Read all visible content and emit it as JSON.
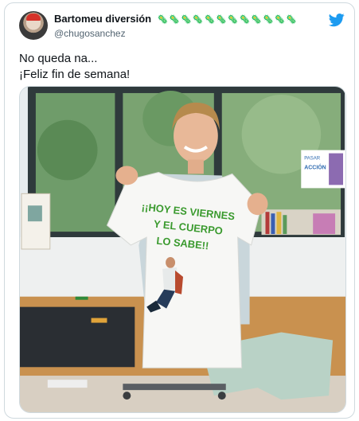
{
  "tweet": {
    "display_name": "Bartomeu diversión",
    "name_emojis": "🦠🦠🦠🦠🦠🦠🦠🦠🦠🦠🦠🦠",
    "handle": "@chugosanchez",
    "text_line1": "No queda na...",
    "text_line2": "¡Feliz fin de semana!"
  },
  "media": {
    "shirt_text": [
      "¡¡HOY ES VIERNES",
      "Y EL CUERPO",
      "LO SABE!!"
    ],
    "wall_sign": [
      "PASAR",
      "ACCIÓN"
    ]
  },
  "colors": {
    "twitter_blue": "#1d9bf0",
    "shirt_green": "#3a9a2e"
  },
  "icons": {
    "platform": "twitter-bird-icon",
    "avatar": "user-avatar"
  }
}
